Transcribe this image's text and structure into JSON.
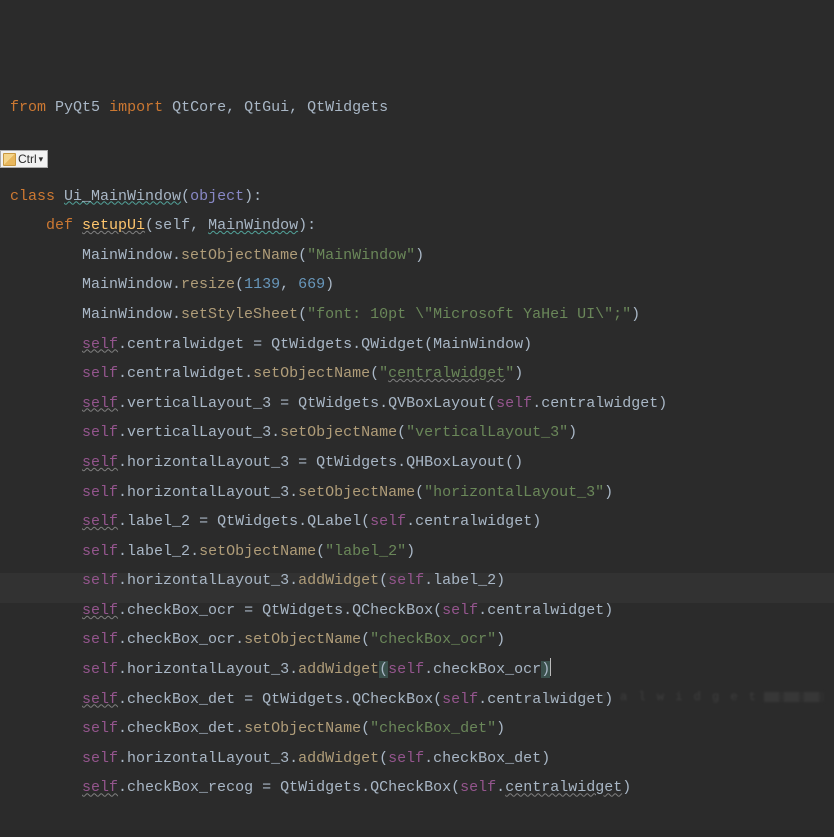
{
  "popup": {
    "label": "Ctrl",
    "extra": "▾"
  },
  "lines": [
    [
      {
        "t": "from",
        "c": "kw"
      },
      {
        "t": " "
      },
      {
        "t": "PyQt5",
        "c": "cls"
      },
      {
        "t": " "
      },
      {
        "t": "import",
        "c": "kw"
      },
      {
        "t": " "
      },
      {
        "t": "QtCore",
        "c": "cls"
      },
      {
        "t": ", ",
        "c": "punct"
      },
      {
        "t": "QtGui",
        "c": "cls"
      },
      {
        "t": ", ",
        "c": "punct"
      },
      {
        "t": "QtWidgets",
        "c": "cls"
      }
    ],
    [],
    [],
    [
      {
        "t": "class ",
        "c": "kw"
      },
      {
        "t": "Ui_MainWindow",
        "c": "cls wavy-teal"
      },
      {
        "t": "(",
        "c": "punct"
      },
      {
        "t": "object",
        "c": "builtin"
      },
      {
        "t": ")",
        "c": "punct"
      },
      {
        "t": ":",
        "c": "punct"
      }
    ],
    [
      {
        "t": "    "
      },
      {
        "t": "def ",
        "c": "kw"
      },
      {
        "t": "setupUi",
        "c": "fn wavy"
      },
      {
        "t": "(",
        "c": "punct"
      },
      {
        "t": "self",
        "c": "param"
      },
      {
        "t": ", ",
        "c": "punct"
      },
      {
        "t": "MainWindow",
        "c": "param wavy-teal"
      },
      {
        "t": ")",
        "c": "punct"
      },
      {
        "t": ":",
        "c": "punct"
      }
    ],
    [
      {
        "t": "        "
      },
      {
        "t": "MainWindow",
        "c": "attr"
      },
      {
        "t": ".",
        "c": "punct"
      },
      {
        "t": "setObjectName",
        "c": "method"
      },
      {
        "t": "(",
        "c": "punct"
      },
      {
        "t": "\"MainWindow\"",
        "c": "str"
      },
      {
        "t": ")",
        "c": "punct"
      }
    ],
    [
      {
        "t": "        "
      },
      {
        "t": "MainWindow",
        "c": "attr"
      },
      {
        "t": ".",
        "c": "punct"
      },
      {
        "t": "resize",
        "c": "method"
      },
      {
        "t": "(",
        "c": "punct"
      },
      {
        "t": "1139",
        "c": "num"
      },
      {
        "t": ", ",
        "c": "punct"
      },
      {
        "t": "669",
        "c": "num"
      },
      {
        "t": ")",
        "c": "punct"
      }
    ],
    [
      {
        "t": "        "
      },
      {
        "t": "MainWindow",
        "c": "attr"
      },
      {
        "t": ".",
        "c": "punct"
      },
      {
        "t": "setStyleSheet",
        "c": "method"
      },
      {
        "t": "(",
        "c": "punct"
      },
      {
        "t": "\"font: 10pt \\\"Microsoft YaHei UI\\\";\"",
        "c": "str"
      },
      {
        "t": ")",
        "c": "punct"
      }
    ],
    [
      {
        "t": "        "
      },
      {
        "t": "self",
        "c": "self wavy"
      },
      {
        "t": ".",
        "c": "punct"
      },
      {
        "t": "centralwidget",
        "c": "attr"
      },
      {
        "t": " = ",
        "c": "punct"
      },
      {
        "t": "QtWidgets",
        "c": "qclass"
      },
      {
        "t": ".",
        "c": "punct"
      },
      {
        "t": "QWidget",
        "c": "cls"
      },
      {
        "t": "(",
        "c": "punct"
      },
      {
        "t": "MainWindow",
        "c": "param"
      },
      {
        "t": ")",
        "c": "punct"
      }
    ],
    [
      {
        "t": "        "
      },
      {
        "t": "self",
        "c": "self"
      },
      {
        "t": ".",
        "c": "punct"
      },
      {
        "t": "centralwidget",
        "c": "attr"
      },
      {
        "t": ".",
        "c": "punct"
      },
      {
        "t": "setObjectName",
        "c": "method"
      },
      {
        "t": "(",
        "c": "punct"
      },
      {
        "t": "\"",
        "c": "str"
      },
      {
        "t": "centralwidget",
        "c": "str wavy"
      },
      {
        "t": "\"",
        "c": "str"
      },
      {
        "t": ")",
        "c": "punct"
      }
    ],
    [
      {
        "t": "        "
      },
      {
        "t": "self",
        "c": "self wavy"
      },
      {
        "t": ".",
        "c": "punct"
      },
      {
        "t": "verticalLayout_3",
        "c": "attr"
      },
      {
        "t": " = ",
        "c": "punct"
      },
      {
        "t": "QtWidgets",
        "c": "qclass"
      },
      {
        "t": ".",
        "c": "punct"
      },
      {
        "t": "QVBoxLayout",
        "c": "cls"
      },
      {
        "t": "(",
        "c": "punct"
      },
      {
        "t": "self",
        "c": "self"
      },
      {
        "t": ".",
        "c": "punct"
      },
      {
        "t": "centralwidget",
        "c": "attr"
      },
      {
        "t": ")",
        "c": "punct"
      }
    ],
    [
      {
        "t": "        "
      },
      {
        "t": "self",
        "c": "self"
      },
      {
        "t": ".",
        "c": "punct"
      },
      {
        "t": "verticalLayout_3",
        "c": "attr"
      },
      {
        "t": ".",
        "c": "punct"
      },
      {
        "t": "setObjectName",
        "c": "method"
      },
      {
        "t": "(",
        "c": "punct"
      },
      {
        "t": "\"verticalLayout_3\"",
        "c": "str"
      },
      {
        "t": ")",
        "c": "punct"
      }
    ],
    [
      {
        "t": "        "
      },
      {
        "t": "self",
        "c": "self wavy"
      },
      {
        "t": ".",
        "c": "punct"
      },
      {
        "t": "horizontalLayout_3",
        "c": "attr"
      },
      {
        "t": " = ",
        "c": "punct"
      },
      {
        "t": "QtWidgets",
        "c": "qclass"
      },
      {
        "t": ".",
        "c": "punct"
      },
      {
        "t": "QHBoxLayout",
        "c": "cls"
      },
      {
        "t": "()",
        "c": "punct"
      }
    ],
    [
      {
        "t": "        "
      },
      {
        "t": "self",
        "c": "self"
      },
      {
        "t": ".",
        "c": "punct"
      },
      {
        "t": "horizontalLayout_3",
        "c": "attr"
      },
      {
        "t": ".",
        "c": "punct"
      },
      {
        "t": "setObjectName",
        "c": "method"
      },
      {
        "t": "(",
        "c": "punct"
      },
      {
        "t": "\"horizontalLayout_3\"",
        "c": "str"
      },
      {
        "t": ")",
        "c": "punct"
      }
    ],
    [
      {
        "t": "        "
      },
      {
        "t": "self",
        "c": "self wavy"
      },
      {
        "t": ".",
        "c": "punct"
      },
      {
        "t": "label_2",
        "c": "attr"
      },
      {
        "t": " = ",
        "c": "punct"
      },
      {
        "t": "QtWidgets",
        "c": "qclass"
      },
      {
        "t": ".",
        "c": "punct"
      },
      {
        "t": "QLabel",
        "c": "cls"
      },
      {
        "t": "(",
        "c": "punct"
      },
      {
        "t": "self",
        "c": "self"
      },
      {
        "t": ".",
        "c": "punct"
      },
      {
        "t": "centralwidget",
        "c": "attr"
      },
      {
        "t": ")",
        "c": "punct"
      }
    ],
    [
      {
        "t": "        "
      },
      {
        "t": "self",
        "c": "self"
      },
      {
        "t": ".",
        "c": "punct"
      },
      {
        "t": "label_2",
        "c": "attr"
      },
      {
        "t": ".",
        "c": "punct"
      },
      {
        "t": "setObjectName",
        "c": "method"
      },
      {
        "t": "(",
        "c": "punct"
      },
      {
        "t": "\"label_2\"",
        "c": "str"
      },
      {
        "t": ")",
        "c": "punct"
      }
    ],
    [
      {
        "t": "        "
      },
      {
        "t": "self",
        "c": "self"
      },
      {
        "t": ".",
        "c": "punct"
      },
      {
        "t": "horizontalLayout_3",
        "c": "attr"
      },
      {
        "t": ".",
        "c": "punct"
      },
      {
        "t": "addWidget",
        "c": "method"
      },
      {
        "t": "(",
        "c": "punct"
      },
      {
        "t": "self",
        "c": "self"
      },
      {
        "t": ".",
        "c": "punct"
      },
      {
        "t": "label_2",
        "c": "attr"
      },
      {
        "t": ")",
        "c": "punct"
      }
    ],
    [
      {
        "t": "        "
      },
      {
        "t": "self",
        "c": "self wavy"
      },
      {
        "t": ".",
        "c": "punct"
      },
      {
        "t": "checkBox_ocr",
        "c": "attr"
      },
      {
        "t": " = ",
        "c": "punct"
      },
      {
        "t": "QtWidgets",
        "c": "qclass"
      },
      {
        "t": ".",
        "c": "punct"
      },
      {
        "t": "QCheckBox",
        "c": "cls"
      },
      {
        "t": "(",
        "c": "punct"
      },
      {
        "t": "self",
        "c": "self"
      },
      {
        "t": ".",
        "c": "punct"
      },
      {
        "t": "centralwidget",
        "c": "attr"
      },
      {
        "t": ")",
        "c": "punct"
      }
    ],
    [
      {
        "t": "        "
      },
      {
        "t": "self",
        "c": "self"
      },
      {
        "t": ".",
        "c": "punct"
      },
      {
        "t": "checkBox_ocr",
        "c": "attr"
      },
      {
        "t": ".",
        "c": "punct"
      },
      {
        "t": "setObjectName",
        "c": "method"
      },
      {
        "t": "(",
        "c": "punct"
      },
      {
        "t": "\"checkBox_ocr\"",
        "c": "str"
      },
      {
        "t": ")",
        "c": "punct"
      }
    ],
    [
      {
        "t": "        "
      },
      {
        "t": "self",
        "c": "self"
      },
      {
        "t": ".",
        "c": "punct"
      },
      {
        "t": "horizontalLayout_3",
        "c": "attr"
      },
      {
        "t": ".",
        "c": "punct"
      },
      {
        "t": "addWidget",
        "c": "method"
      },
      {
        "t": "(",
        "c": "punct highlight-box"
      },
      {
        "t": "self",
        "c": "self"
      },
      {
        "t": ".",
        "c": "punct"
      },
      {
        "t": "checkBox_ocr",
        "c": "attr"
      },
      {
        "t": ")",
        "c": "punct highlight-box"
      },
      {
        "t": "",
        "caret": true
      }
    ],
    [
      {
        "t": "        "
      },
      {
        "t": "self",
        "c": "self wavy"
      },
      {
        "t": ".",
        "c": "punct"
      },
      {
        "t": "checkBox_det",
        "c": "attr"
      },
      {
        "t": " = ",
        "c": "punct"
      },
      {
        "t": "QtWidgets",
        "c": "qclass"
      },
      {
        "t": ".",
        "c": "punct"
      },
      {
        "t": "QCheckBox",
        "c": "cls"
      },
      {
        "t": "(",
        "c": "punct"
      },
      {
        "t": "self",
        "c": "self"
      },
      {
        "t": ".",
        "c": "punct"
      },
      {
        "t": "centralwidget",
        "c": "attr"
      },
      {
        "t": ")",
        "c": "punct"
      }
    ],
    [
      {
        "t": "        "
      },
      {
        "t": "self",
        "c": "self"
      },
      {
        "t": ".",
        "c": "punct"
      },
      {
        "t": "checkBox_det",
        "c": "attr"
      },
      {
        "t": ".",
        "c": "punct"
      },
      {
        "t": "setObjectName",
        "c": "method"
      },
      {
        "t": "(",
        "c": "punct"
      },
      {
        "t": "\"checkBox_det\"",
        "c": "str"
      },
      {
        "t": ")",
        "c": "punct"
      }
    ],
    [
      {
        "t": "        "
      },
      {
        "t": "self",
        "c": "self"
      },
      {
        "t": ".",
        "c": "punct"
      },
      {
        "t": "horizontalLayout_3",
        "c": "attr"
      },
      {
        "t": ".",
        "c": "punct"
      },
      {
        "t": "addWidget",
        "c": "method"
      },
      {
        "t": "(",
        "c": "punct"
      },
      {
        "t": "self",
        "c": "self"
      },
      {
        "t": ".",
        "c": "punct"
      },
      {
        "t": "checkBox_det",
        "c": "attr"
      },
      {
        "t": ")",
        "c": "punct"
      }
    ],
    [
      {
        "t": "        "
      },
      {
        "t": "self",
        "c": "self wavy"
      },
      {
        "t": ".",
        "c": "punct"
      },
      {
        "t": "checkBox_recog",
        "c": "attr"
      },
      {
        "t": " = ",
        "c": "punct"
      },
      {
        "t": "QtWidgets",
        "c": "qclass"
      },
      {
        "t": ".",
        "c": "punct"
      },
      {
        "t": "QCheckBox",
        "c": "cls"
      },
      {
        "t": "(",
        "c": "punct"
      },
      {
        "t": "self",
        "c": "self"
      },
      {
        "t": ".",
        "c": "punct"
      },
      {
        "t": "centralwidget",
        "c": "attr wavy"
      },
      {
        "t": ")",
        "c": "punct"
      }
    ]
  ]
}
